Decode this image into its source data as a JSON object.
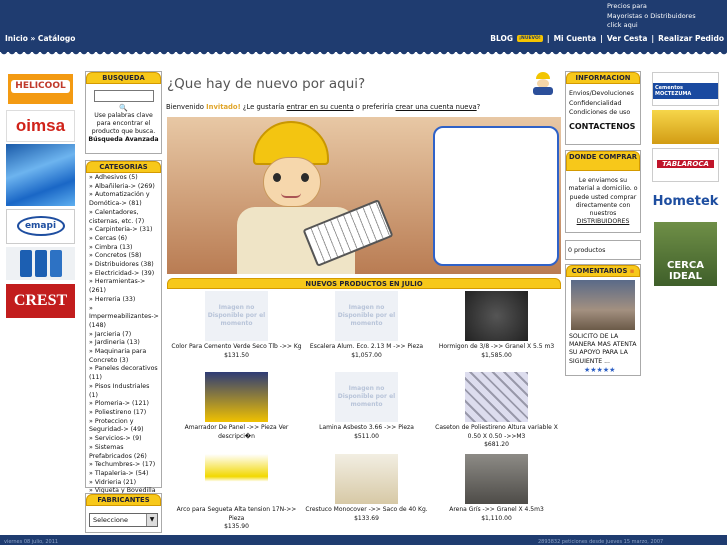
{
  "header": {
    "promo_line1": "Precios para",
    "promo_line2": "Mayoristas o Distribuidores",
    "promo_line3": "click aqui",
    "breadcrumb": "Inicio » Catálogo",
    "blog": "BLOG",
    "blog_badge": "¡NUEVO!",
    "sep": "|",
    "mi_cuenta": "Mi Cuenta",
    "ver_cesta": "Ver Cesta",
    "realizar_pedido": "Realizar Pedido"
  },
  "left_brands": [
    "HELICOOL",
    "oimsa",
    "emapi",
    "CREST"
  ],
  "right_brands": [
    "Cementos MOCTEZUMA",
    "TABLAROCA",
    "Hometek",
    "CERCA IDEAL"
  ],
  "busqueda": {
    "title": "BUSQUEDA",
    "hint": "Use palabras clave para encontrar el producto que busca.",
    "advanced": "Búsqueda Avanzada",
    "input_value": ""
  },
  "categorias": {
    "title": "CATEGORIAS",
    "items": [
      "» Adhesivos (5)",
      "» Albañileria-> (269)",
      "» Automatización y Domótica-> (81)",
      "» Calentadores, cisternas, etc. (7)",
      "» Carpinteria-> (31)",
      "» Cercas (6)",
      "» Cimbra (13)",
      "» Concretos (58)",
      "» Distribuidores (38)",
      "» Electricidad-> (39)",
      "» Herramientas-> (261)",
      "» Herreria (33)",
      "» Impermeabilizantes-> (148)",
      "» Jarcieria (7)",
      "» Jardineria (13)",
      "» Maquinaria para Concreto (3)",
      "» Paneles decorativos (11)",
      "» Pisos Industriales (1)",
      "» Plomeria-> (121)",
      "» Poliestireno (17)",
      "» Proteccion y Seguridad-> (49)",
      "» Servicios-> (9)",
      "» Sistemas Prefabricados (26)",
      "» Techumbres-> (17)",
      "» Tlapaleria-> (54)",
      "» Vidrieria (21)",
      "» Vigueta y Bovedilla (24)"
    ]
  },
  "fabricantes": {
    "title": "FABRICANTES",
    "select_value": "Seleccione"
  },
  "main": {
    "title": "¿Que hay de nuevo por aqui?",
    "welcome_pre": "Bienvenido",
    "guest": "Invitado!",
    "welcome_mid": "¿Le gustaría",
    "login": "entrar en su cuenta",
    "or": "o preferiría",
    "signup": "crear una cuenta nueva",
    "end": "?"
  },
  "nuevos": {
    "title": "NUEVOS PRODUCTOS EN JULIO",
    "products": [
      {
        "name": "Color Para Cemento Verde Seco Tlb ->> Kg",
        "price": "$131.50",
        "img": "none"
      },
      {
        "name": "Escalera Alum. Eco. 2.13 M ->> Pieza",
        "price": "$1,057.00",
        "img": "none"
      },
      {
        "name": "Hormigon de 3/8 ->> Granel X 5.5 m3",
        "price": "$1,585.00",
        "img": "gravel"
      },
      {
        "name": "Amarrador De Panel ->> Pieza Ver descripci�n",
        "price": "",
        "img": "panel"
      },
      {
        "name": "Lamina Asbesto 3.66 ->> Pieza",
        "price": "$511.00",
        "img": "none"
      },
      {
        "name": "Caseton de Poliestireno Altura variable X 0.50 X 0.50 ->>M3",
        "price": "$681.20",
        "img": "foam"
      },
      {
        "name": "Arco para Segueta Alta tension 17N->> Pieza",
        "price": "$135.90",
        "img": "saw"
      },
      {
        "name": "Crestuco Monocover ->> Saco de 40 Kg.",
        "price": "$133.69",
        "img": "sack"
      },
      {
        "name": "Arena Grís ->> Granel X 4.5m3",
        "price": "$1,110.00",
        "img": "sand"
      }
    ],
    "noimg_text": "Imagen no Disponible por el momento"
  },
  "informacion": {
    "title": "INFORMACION",
    "links": [
      "Envios/Devoluciones",
      "Confidencialidad",
      "Condiciones de uso"
    ],
    "contact": "CONTACTENOS"
  },
  "donde": {
    "title": "DONDE COMPRAR",
    "text": "Le enviamos su material a domicilio. o puede usted comprar directamente con nuestros",
    "link": "DISTRIBUIDORES"
  },
  "cart": {
    "text": "0 productos"
  },
  "comentarios": {
    "title": "COMENTARIOS",
    "text": "SOLICITO DE LA MANERA MAS ATENTA SU APOYO PARA LA SIGUIENTE ...",
    "stars": "★★★★★"
  },
  "footer": {
    "date": "viernes 08 julio, 2011",
    "counter": "2893832 peticiones desde jueves 15 marzo, 2007"
  },
  "colors": {
    "navy": "#1f3c70",
    "yellow": "#f7c81a"
  }
}
